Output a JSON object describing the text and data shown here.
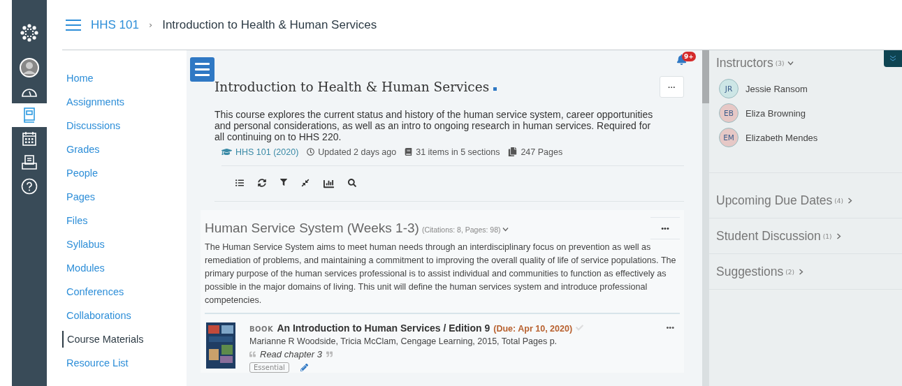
{
  "global_nav": [
    {
      "kind": "logo",
      "selected": false
    },
    {
      "kind": "account",
      "selected": false
    },
    {
      "kind": "dashboard",
      "selected": false
    },
    {
      "kind": "courses",
      "selected": true
    },
    {
      "kind": "calendar",
      "selected": false
    },
    {
      "kind": "inbox",
      "selected": false
    },
    {
      "kind": "help",
      "selected": false
    }
  ],
  "breadcrumb": {
    "course": "HHS 101",
    "separator": "›",
    "page": "Introduction to Health & Human Services"
  },
  "course_nav": [
    {
      "label": "Home",
      "selected": false
    },
    {
      "label": "Assignments",
      "selected": false
    },
    {
      "label": "Discussions",
      "selected": false
    },
    {
      "label": "Grades",
      "selected": false
    },
    {
      "label": "People",
      "selected": false
    },
    {
      "label": "Pages",
      "selected": false
    },
    {
      "label": "Files",
      "selected": false
    },
    {
      "label": "Syllabus",
      "selected": false
    },
    {
      "label": "Modules",
      "selected": false
    },
    {
      "label": "Conferences",
      "selected": false
    },
    {
      "label": "Collaborations",
      "selected": false
    },
    {
      "label": "Course Materials",
      "selected": true
    },
    {
      "label": "Resource List",
      "selected": false
    }
  ],
  "notifications": {
    "badge": "9+"
  },
  "course": {
    "title": "Introduction to Health & Human Services",
    "more": "···",
    "description": "This course explores the current status and history of the human service system, career opportunities and personal considerations, as well as an intro to ongoing research in human services. Required for all continuing on to HHS 220.",
    "meta": [
      {
        "kind": "course",
        "text": "HHS 101 (2020)"
      },
      {
        "kind": "updated",
        "text": "Updated 2 days ago"
      },
      {
        "kind": "items",
        "text": "31 items in 5 sections"
      },
      {
        "kind": "pages",
        "text": "247 Pages"
      }
    ]
  },
  "toolbar": [
    {
      "kind": "list"
    },
    {
      "kind": "refresh"
    },
    {
      "kind": "filter"
    },
    {
      "kind": "collapse"
    },
    {
      "kind": "chart"
    },
    {
      "kind": "search"
    }
  ],
  "section": {
    "title": "Human Service System (Weeks 1-3)",
    "stats": "(Citations: 8, Pages: 98)",
    "more": "•••",
    "description": "The Human Service System aims to meet human needs through an interdisciplinary focus on prevention as well as remediation of problems, and maintaining a commitment to improving the overall quality of life of service populations. The primary purpose of the human services professional is to assist individual and communities to function as effectively as possible in the major domains of living. This unit will define the human services system and introduce professional competencies.",
    "items": [
      {
        "type": "BOOK",
        "title": "An Introduction to Human Services / Edition 9",
        "due": "(Due:  Apr 10, 2020)",
        "done": false,
        "authors": "Marianne R Woodside, Tricia McClam,  Cengage Learning,  2015,  Total Pages p.",
        "note": "Read chapter 3",
        "tag": "Essential",
        "more": "•••"
      }
    ]
  },
  "sidebar": {
    "instructors": {
      "title": "Instructors",
      "count": "(3)",
      "expanded": true,
      "people": [
        {
          "initials": "JR",
          "name": "Jessie Ransom",
          "color": "#cde6e6"
        },
        {
          "initials": "EB",
          "name": "Eliza Browning",
          "color": "#e6c8c6"
        },
        {
          "initials": "EM",
          "name": "Elizabeth Mendes",
          "color": "#e6c8c6"
        }
      ]
    },
    "sections": [
      {
        "title": "Upcoming Due Dates",
        "count": "(4)",
        "expanded": false
      },
      {
        "title": "Student Discussion",
        "count": "(1)",
        "expanded": false
      },
      {
        "title": "Suggestions",
        "count": "(2)",
        "expanded": false
      }
    ]
  }
}
